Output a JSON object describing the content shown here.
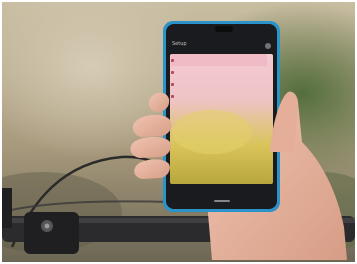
{
  "photo": {
    "description_colors": {
      "background_top": "#b9ab8f",
      "background_bottom": "#6f6a56",
      "phone_frame": "#2a93c9",
      "screen_dark": "#1b1c1f",
      "screen_content_top": "#f2c9cf",
      "screen_content_bottom": "#d8c74a",
      "hand": "#e7b6a2"
    }
  },
  "screen": {
    "title": "Setup",
    "items": [
      {
        "label": "",
        "active": true
      },
      {
        "label": "",
        "active": false
      },
      {
        "label": "",
        "active": false
      },
      {
        "label": "",
        "active": false
      }
    ]
  }
}
